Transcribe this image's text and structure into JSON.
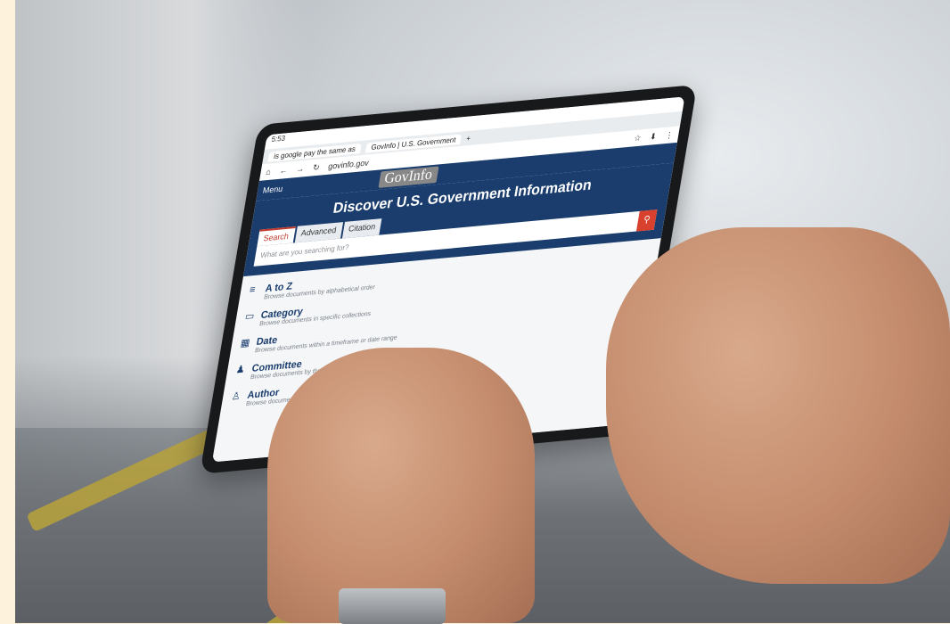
{
  "browser": {
    "status_time": "5:53",
    "tab_1": "is google pay the same as",
    "tab_2": "GovInfo | U.S. Government",
    "url": "govinfo.gov"
  },
  "site": {
    "menu_label": "Menu",
    "logo": "GovInfo",
    "hero_title": "Discover U.S. Government Information",
    "search_tabs": [
      "Search",
      "Advanced",
      "Citation"
    ],
    "search_placeholder": "What are you searching for?",
    "browse_items": [
      {
        "icon": "a-to-z-icon",
        "title": "A to Z",
        "desc": "Browse documents by alphabetical order"
      },
      {
        "icon": "category-icon",
        "title": "Category",
        "desc": "Browse documents in specific collections"
      },
      {
        "icon": "calendar-icon",
        "title": "Date",
        "desc": "Browse documents within a timeframe or date range"
      },
      {
        "icon": "committee-icon",
        "title": "Committee",
        "desc": "Browse documents by the issuing committee"
      },
      {
        "icon": "author-icon",
        "title": "Author",
        "desc": "Browse documents by government authors"
      }
    ],
    "cut_text": "ent"
  },
  "colors": {
    "brand_blue": "#1a3d6d",
    "accent_red": "#d9412f"
  }
}
